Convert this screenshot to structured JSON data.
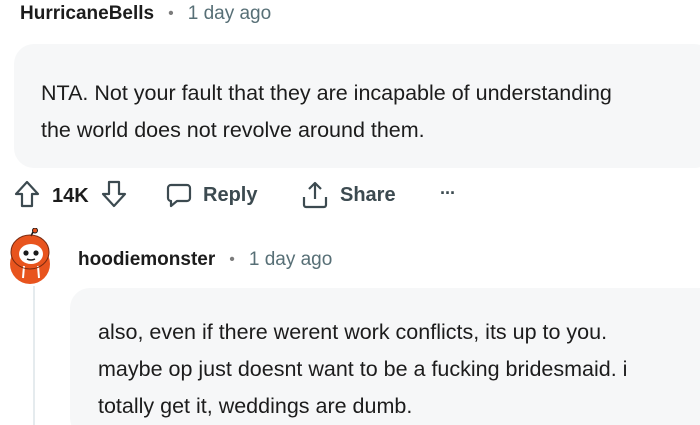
{
  "comment1": {
    "author": "HurricaneBells",
    "separator": "•",
    "time": "1 day ago",
    "lines": [
      "NTA. Not your fault that they are incapable of understanding",
      "the world does not revolve around them."
    ]
  },
  "actions": {
    "upvote_icon": "arrow-up-icon",
    "score": "14K",
    "downvote_icon": "arrow-down-icon",
    "reply_label": "Reply",
    "reply_icon": "comment-bubble-icon",
    "share_label": "Share",
    "share_icon": "share-icon",
    "more_label": "···",
    "more_icon": "more-icon"
  },
  "comment2": {
    "author": "hoodiemonster",
    "separator": "•",
    "time": "1 day ago",
    "avatar_icon": "snoo-avatar-icon",
    "lines": [
      "also, even if there werent work conflicts, its up to you.",
      "maybe op just doesnt want to be a fucking bridesmaid. i",
      "totally get it, weddings are dumb."
    ]
  },
  "colors": {
    "bubble_bg": "#f6f7f8",
    "meta_text": "#576f76",
    "action_text": "#3c4a50",
    "avatar_orange": "#e8541e"
  }
}
